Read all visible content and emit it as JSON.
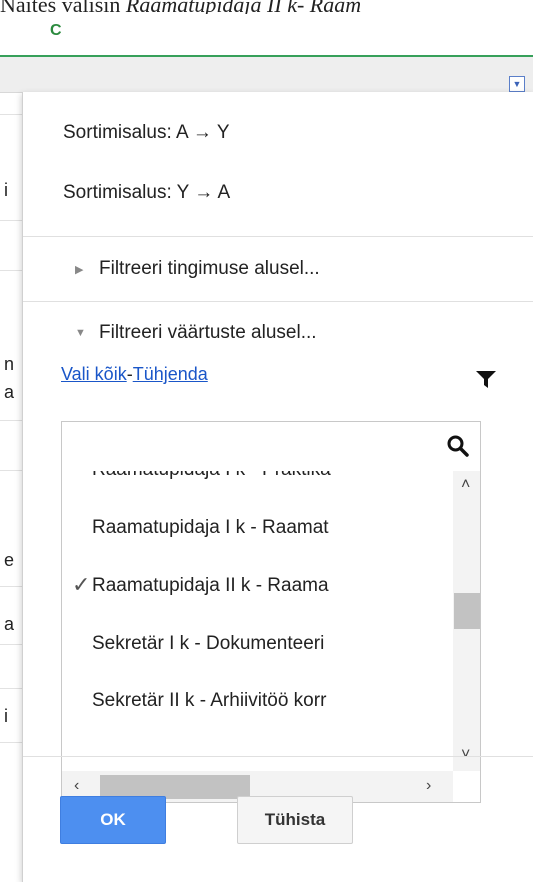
{
  "top_partial_text": {
    "plain": "Näites valisin ",
    "italic": "Raamatupidaja II k- Raam"
  },
  "column_letter": "C",
  "left_fragments": [
    "i",
    "n",
    "a",
    "e",
    "a",
    "i"
  ],
  "sort": {
    "asc": "Sortimisalus: A → Y",
    "desc": "Sortimisalus: Y → A"
  },
  "filter": {
    "by_condition": "Filtreeri tingimuse alusel...",
    "by_values": "Filtreeri väärtuste alusel...",
    "select_all": "Vali kõik",
    "separator": "-",
    "clear": "Tühjenda"
  },
  "search": {
    "value": "",
    "placeholder": ""
  },
  "values": [
    {
      "label": "Raamatupidaja I k - Praktika",
      "checked": false
    },
    {
      "label": "Raamatupidaja I k - Raamat",
      "checked": false
    },
    {
      "label": "Raamatupidaja II k - Raama",
      "checked": true
    },
    {
      "label": "Sekretär I k - Dokumenteeri",
      "checked": false
    },
    {
      "label": "Sekretär II k - Arhiivitöö korr",
      "checked": false
    }
  ],
  "buttons": {
    "ok": "OK",
    "cancel": "Tühista"
  },
  "icons": {
    "funnel": "filter-funnel-icon",
    "search": "search-icon",
    "check": "checkmark-icon",
    "dropdown": "dropdown-arrow-icon"
  },
  "colors": {
    "ok_button": "#4d8ff0",
    "link": "#1a56c8",
    "column_green": "#37a05a"
  }
}
